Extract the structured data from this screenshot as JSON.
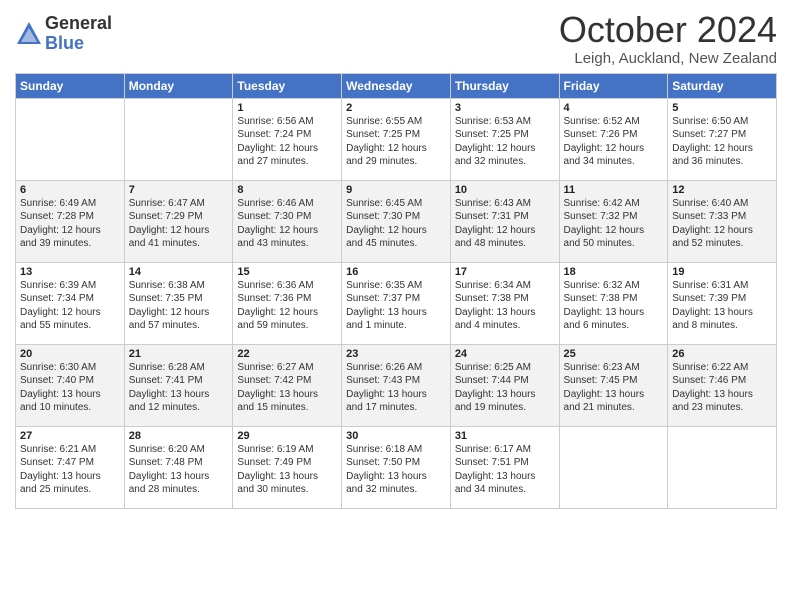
{
  "logo": {
    "general": "General",
    "blue": "Blue"
  },
  "title": "October 2024",
  "location": "Leigh, Auckland, New Zealand",
  "days_header": [
    "Sunday",
    "Monday",
    "Tuesday",
    "Wednesday",
    "Thursday",
    "Friday",
    "Saturday"
  ],
  "weeks": [
    [
      {
        "day": "",
        "info": ""
      },
      {
        "day": "",
        "info": ""
      },
      {
        "day": "1",
        "info": "Sunrise: 6:56 AM\nSunset: 7:24 PM\nDaylight: 12 hours\nand 27 minutes."
      },
      {
        "day": "2",
        "info": "Sunrise: 6:55 AM\nSunset: 7:25 PM\nDaylight: 12 hours\nand 29 minutes."
      },
      {
        "day": "3",
        "info": "Sunrise: 6:53 AM\nSunset: 7:25 PM\nDaylight: 12 hours\nand 32 minutes."
      },
      {
        "day": "4",
        "info": "Sunrise: 6:52 AM\nSunset: 7:26 PM\nDaylight: 12 hours\nand 34 minutes."
      },
      {
        "day": "5",
        "info": "Sunrise: 6:50 AM\nSunset: 7:27 PM\nDaylight: 12 hours\nand 36 minutes."
      }
    ],
    [
      {
        "day": "6",
        "info": "Sunrise: 6:49 AM\nSunset: 7:28 PM\nDaylight: 12 hours\nand 39 minutes."
      },
      {
        "day": "7",
        "info": "Sunrise: 6:47 AM\nSunset: 7:29 PM\nDaylight: 12 hours\nand 41 minutes."
      },
      {
        "day": "8",
        "info": "Sunrise: 6:46 AM\nSunset: 7:30 PM\nDaylight: 12 hours\nand 43 minutes."
      },
      {
        "day": "9",
        "info": "Sunrise: 6:45 AM\nSunset: 7:30 PM\nDaylight: 12 hours\nand 45 minutes."
      },
      {
        "day": "10",
        "info": "Sunrise: 6:43 AM\nSunset: 7:31 PM\nDaylight: 12 hours\nand 48 minutes."
      },
      {
        "day": "11",
        "info": "Sunrise: 6:42 AM\nSunset: 7:32 PM\nDaylight: 12 hours\nand 50 minutes."
      },
      {
        "day": "12",
        "info": "Sunrise: 6:40 AM\nSunset: 7:33 PM\nDaylight: 12 hours\nand 52 minutes."
      }
    ],
    [
      {
        "day": "13",
        "info": "Sunrise: 6:39 AM\nSunset: 7:34 PM\nDaylight: 12 hours\nand 55 minutes."
      },
      {
        "day": "14",
        "info": "Sunrise: 6:38 AM\nSunset: 7:35 PM\nDaylight: 12 hours\nand 57 minutes."
      },
      {
        "day": "15",
        "info": "Sunrise: 6:36 AM\nSunset: 7:36 PM\nDaylight: 12 hours\nand 59 minutes."
      },
      {
        "day": "16",
        "info": "Sunrise: 6:35 AM\nSunset: 7:37 PM\nDaylight: 13 hours\nand 1 minute."
      },
      {
        "day": "17",
        "info": "Sunrise: 6:34 AM\nSunset: 7:38 PM\nDaylight: 13 hours\nand 4 minutes."
      },
      {
        "day": "18",
        "info": "Sunrise: 6:32 AM\nSunset: 7:38 PM\nDaylight: 13 hours\nand 6 minutes."
      },
      {
        "day": "19",
        "info": "Sunrise: 6:31 AM\nSunset: 7:39 PM\nDaylight: 13 hours\nand 8 minutes."
      }
    ],
    [
      {
        "day": "20",
        "info": "Sunrise: 6:30 AM\nSunset: 7:40 PM\nDaylight: 13 hours\nand 10 minutes."
      },
      {
        "day": "21",
        "info": "Sunrise: 6:28 AM\nSunset: 7:41 PM\nDaylight: 13 hours\nand 12 minutes."
      },
      {
        "day": "22",
        "info": "Sunrise: 6:27 AM\nSunset: 7:42 PM\nDaylight: 13 hours\nand 15 minutes."
      },
      {
        "day": "23",
        "info": "Sunrise: 6:26 AM\nSunset: 7:43 PM\nDaylight: 13 hours\nand 17 minutes."
      },
      {
        "day": "24",
        "info": "Sunrise: 6:25 AM\nSunset: 7:44 PM\nDaylight: 13 hours\nand 19 minutes."
      },
      {
        "day": "25",
        "info": "Sunrise: 6:23 AM\nSunset: 7:45 PM\nDaylight: 13 hours\nand 21 minutes."
      },
      {
        "day": "26",
        "info": "Sunrise: 6:22 AM\nSunset: 7:46 PM\nDaylight: 13 hours\nand 23 minutes."
      }
    ],
    [
      {
        "day": "27",
        "info": "Sunrise: 6:21 AM\nSunset: 7:47 PM\nDaylight: 13 hours\nand 25 minutes."
      },
      {
        "day": "28",
        "info": "Sunrise: 6:20 AM\nSunset: 7:48 PM\nDaylight: 13 hours\nand 28 minutes."
      },
      {
        "day": "29",
        "info": "Sunrise: 6:19 AM\nSunset: 7:49 PM\nDaylight: 13 hours\nand 30 minutes."
      },
      {
        "day": "30",
        "info": "Sunrise: 6:18 AM\nSunset: 7:50 PM\nDaylight: 13 hours\nand 32 minutes."
      },
      {
        "day": "31",
        "info": "Sunrise: 6:17 AM\nSunset: 7:51 PM\nDaylight: 13 hours\nand 34 minutes."
      },
      {
        "day": "",
        "info": ""
      },
      {
        "day": "",
        "info": ""
      }
    ]
  ]
}
